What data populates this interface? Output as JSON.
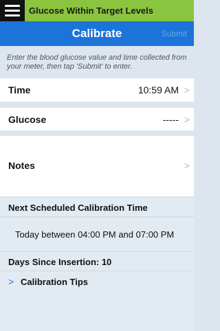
{
  "status": {
    "message": "Glucose Within Target Levels",
    "color": "#8bc53f"
  },
  "nav": {
    "title": "Calibrate",
    "submit_label": "Submit",
    "accent": "#1d74d8"
  },
  "instructions": "Enter the blood glucose value and time collected from your meter, then tap 'Submit' to enter.",
  "form": {
    "time": {
      "label": "Time",
      "value": "10:59 AM"
    },
    "glucose": {
      "label": "Glucose",
      "value": "-----"
    },
    "notes": {
      "label": "Notes"
    }
  },
  "schedule": {
    "heading": "Next Scheduled Calibration Time",
    "window": "Today between 04:00 PM and 07:00 PM"
  },
  "days_since_insertion": "Days Since Insertion: 10",
  "calibration_tips": {
    "label": "Calibration Tips"
  },
  "icons": {
    "menu": "hamburger-menu-icon",
    "disclosure": "chevron-right-icon",
    "expand": "chevron-right-icon"
  }
}
